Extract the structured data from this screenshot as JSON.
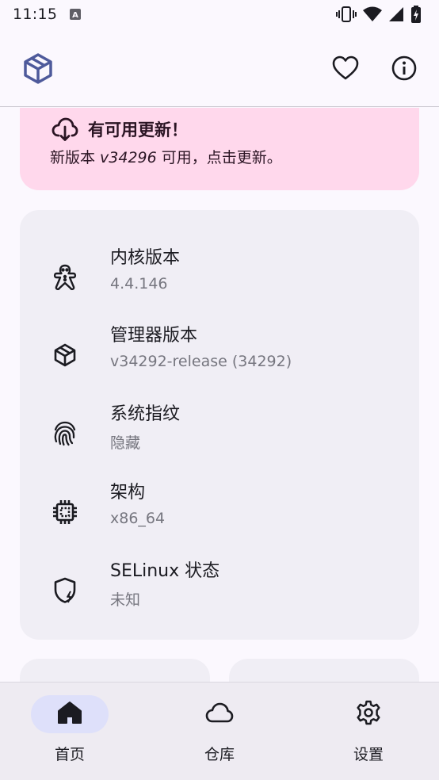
{
  "status_bar": {
    "time": "11:15"
  },
  "colors": {
    "accent": "#4E5A9B",
    "update_card_bg": "#FFD8EC",
    "info_card_bg": "#F0EEF5",
    "nav_active_pill": "#DEE0FA"
  },
  "app_bar": {
    "logo_icon": "cube-icon",
    "actions": [
      {
        "icon": "heart-outline-icon"
      },
      {
        "icon": "info-circle-icon"
      }
    ]
  },
  "update_card": {
    "icon": "cloud-download-icon",
    "title": "有可用更新！",
    "message_prefix": "新版本 ",
    "version": "v34296",
    "message_suffix": " 可用，点击更新。"
  },
  "info_card": {
    "rows": [
      {
        "icon": "gingerbread-icon",
        "label": "内核版本",
        "value": "4.4.146"
      },
      {
        "icon": "cube-icon",
        "label": "管理器版本",
        "value": "v34292-release (34292)"
      },
      {
        "icon": "fingerprint-icon",
        "label": "系统指纹",
        "value": "隐藏"
      },
      {
        "icon": "cpu-chip-icon",
        "label": "架构",
        "value": "x86_64"
      },
      {
        "icon": "shield-bolt-icon",
        "label": "SELinux 状态",
        "value": "未知"
      }
    ]
  },
  "bottom_nav": {
    "items": [
      {
        "icon": "home-icon",
        "label": "首页",
        "active": true
      },
      {
        "icon": "cloud-icon",
        "label": "仓库",
        "active": false
      },
      {
        "icon": "gear-icon",
        "label": "设置",
        "active": false
      }
    ]
  }
}
